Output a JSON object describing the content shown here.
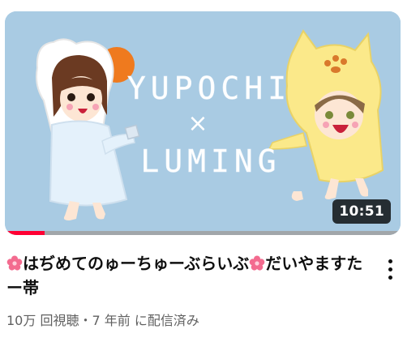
{
  "video": {
    "duration": "10:51",
    "progress": 0.1,
    "thumbnail_text": {
      "line1": "YUPOCHI",
      "cross": "×",
      "line2": "LUMING"
    },
    "title_part1": "はぢめてのゅーちゅーぶらいぶ",
    "title_part2": "だいやますたー帯",
    "title_icon": "cherry-blossom-icon",
    "views": "10万 回視聴",
    "separator": "・",
    "age": "7 年前 に配信済み",
    "menu_icon": "more-vert-icon"
  },
  "colors": {
    "thumb_bg": "#a9cbe3",
    "progress": "#ff0033",
    "flower": "#f36b8f"
  }
}
